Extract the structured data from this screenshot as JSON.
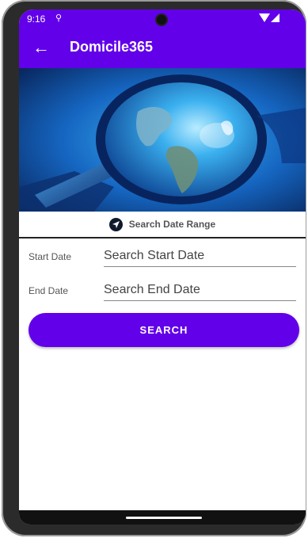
{
  "status_bar": {
    "time": "9:16",
    "vpn_glyph": "⚲"
  },
  "app_bar": {
    "back_icon": "←",
    "title": "Domicile365"
  },
  "hero": {
    "icon": "magnifying-glass-globe-image"
  },
  "section": {
    "label": "Search Date Range"
  },
  "fields": {
    "start": {
      "label": "Start Date",
      "placeholder": "Search Start Date",
      "value": ""
    },
    "end": {
      "label": "End Date",
      "placeholder": "Search End Date",
      "value": ""
    }
  },
  "search_button": {
    "label": "SEARCH"
  },
  "colors": {
    "primary": "#6200ea",
    "divider": "#222222",
    "text_secondary": "#555555"
  }
}
